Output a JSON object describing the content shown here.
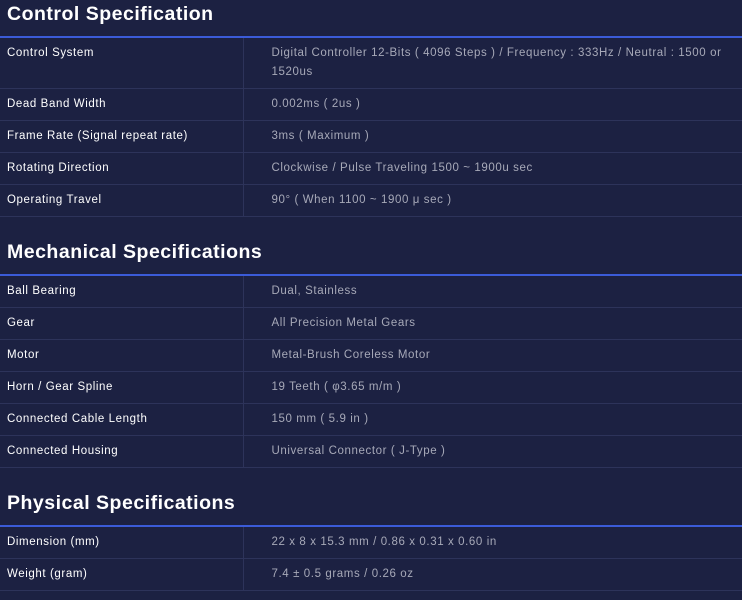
{
  "sections": [
    {
      "title": "Control Specification",
      "rows": [
        {
          "label": "Control System",
          "value": "Digital Controller 12-Bits ( 4096 Steps ) / Frequency : 333Hz / Neutral : 1500 or 1520us"
        },
        {
          "label": "Dead Band Width",
          "value": "0.002ms ( 2us )"
        },
        {
          "label": "Frame Rate (Signal repeat rate)",
          "value": "3ms ( Maximum )"
        },
        {
          "label": "Rotating Direction",
          "value": "Clockwise / Pulse Traveling 1500 ~ 1900u sec"
        },
        {
          "label": "Operating Travel",
          "value": "90° ( When 1100 ~ 1900 μ sec )"
        }
      ]
    },
    {
      "title": "Mechanical Specifications",
      "rows": [
        {
          "label": "Ball Bearing",
          "value": "Dual, Stainless"
        },
        {
          "label": "Gear",
          "value": "All Precision Metal Gears"
        },
        {
          "label": "Motor",
          "value": "Metal-Brush Coreless Motor"
        },
        {
          "label": "Horn / Gear Spline",
          "value": "19 Teeth ( φ3.65 m/m )"
        },
        {
          "label": "Connected Cable Length",
          "value": "150 mm ( 5.9 in )"
        },
        {
          "label": "Connected Housing",
          "value": "Universal Connector ( J-Type )"
        }
      ]
    },
    {
      "title": "Physical Specifications",
      "rows": [
        {
          "label": "Dimension (mm)",
          "value": "22 x 8 x 15.3 mm / 0.86 x 0.31 x 0.60 in"
        },
        {
          "label": "Weight (gram)",
          "value": "7.4 ± 0.5 grams / 0.26 oz"
        }
      ]
    }
  ],
  "colors": {
    "background": "#1c2142",
    "accent_rule": "#3b5bd8",
    "row_divider": "#2d335a",
    "label_text": "#ffffff",
    "value_text": "#a7a9b8"
  }
}
